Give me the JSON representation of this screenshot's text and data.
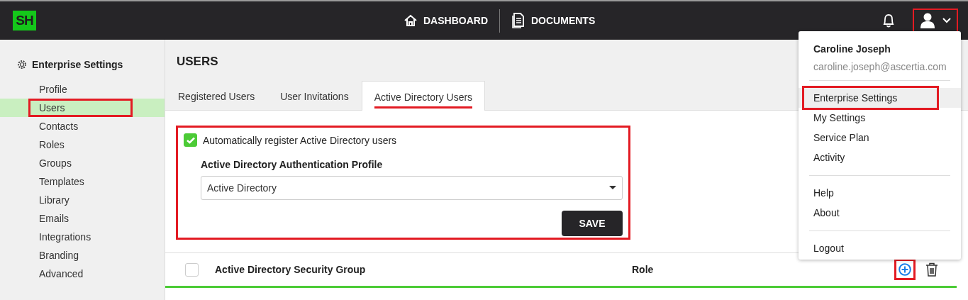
{
  "header": {
    "logo": "SH",
    "nav": [
      {
        "label": "DASHBOARD",
        "kind": "home"
      },
      {
        "label": "DOCUMENTS",
        "kind": "document"
      }
    ],
    "user_button": {
      "highlighted": true
    }
  },
  "sidebar": {
    "title": "Enterprise Settings",
    "items": [
      {
        "label": "Profile",
        "selected": false,
        "highlighted": false
      },
      {
        "label": "Users",
        "selected": true,
        "highlighted": true
      },
      {
        "label": "Contacts",
        "selected": false,
        "highlighted": false
      },
      {
        "label": "Roles",
        "selected": false,
        "highlighted": false
      },
      {
        "label": "Groups",
        "selected": false,
        "highlighted": false
      },
      {
        "label": "Templates",
        "selected": false,
        "highlighted": false
      },
      {
        "label": "Library",
        "selected": false,
        "highlighted": false
      },
      {
        "label": "Emails",
        "selected": false,
        "highlighted": false
      },
      {
        "label": "Integrations",
        "selected": false,
        "highlighted": false
      },
      {
        "label": "Branding",
        "selected": false,
        "highlighted": false
      },
      {
        "label": "Advanced",
        "selected": false,
        "highlighted": false
      }
    ]
  },
  "page_title": "USERS",
  "tabs": [
    {
      "label": "Registered Users",
      "selected": false
    },
    {
      "label": "User Invitations",
      "selected": false
    },
    {
      "label": "Active Directory Users",
      "selected": true
    }
  ],
  "settings_panel": {
    "highlighted": true,
    "auto_register": {
      "label": "Automatically register Active Directory users",
      "checked": true
    },
    "profile_label": "Active Directory Authentication Profile",
    "profile_value": "Active Directory",
    "save": "SAVE"
  },
  "table": {
    "select_all": {
      "checked": false
    },
    "columns": [
      "Active Directory Security Group",
      "Role"
    ],
    "add_button": {
      "highlighted": true
    }
  },
  "user_menu": {
    "name": "Caroline Joseph",
    "email": "caroline.joseph@ascertia.com",
    "sections": [
      [
        {
          "label": "Enterprise Settings",
          "hovered": true,
          "highlighted": true
        },
        {
          "label": "My Settings",
          "hovered": false,
          "highlighted": false
        },
        {
          "label": "Service Plan",
          "hovered": false,
          "highlighted": false
        },
        {
          "label": "Activity",
          "hovered": false,
          "highlighted": false
        }
      ],
      [
        {
          "label": "Help",
          "hovered": false,
          "highlighted": false
        },
        {
          "label": "About",
          "hovered": false,
          "highlighted": false
        }
      ],
      [
        {
          "label": "Logout",
          "hovered": false,
          "highlighted": false
        }
      ]
    ]
  }
}
